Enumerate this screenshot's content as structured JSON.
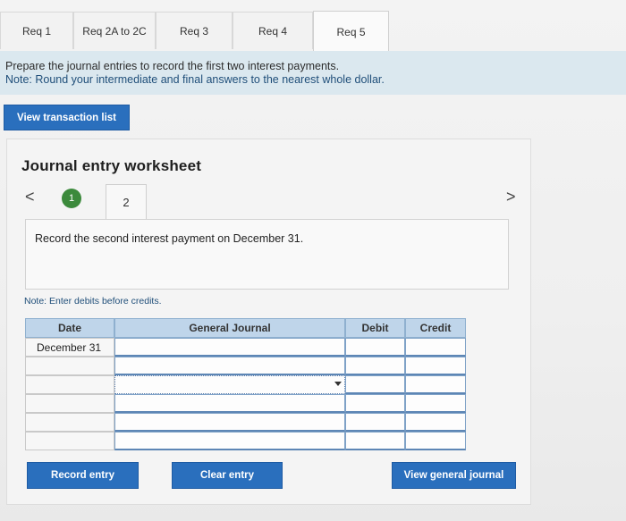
{
  "tabs": [
    {
      "label": "Req 1"
    },
    {
      "label": "Req 2A to 2C"
    },
    {
      "label": "Req 3"
    },
    {
      "label": "Req 4"
    },
    {
      "label": "Req 5",
      "active": true
    }
  ],
  "instructions": {
    "line1": "Prepare the journal entries to record the first two interest payments.",
    "line2": "Note: Round your intermediate and final answers to the nearest whole dollar."
  },
  "view_transaction_label": "View transaction list",
  "worksheet": {
    "title": "Journal entry worksheet",
    "prev_glyph": "<",
    "next_glyph": ">",
    "steps": [
      "1",
      "2"
    ],
    "active_step": "2",
    "instruction": "Record the second interest payment on December 31.",
    "note": "Note: Enter debits before credits."
  },
  "journal": {
    "headers": {
      "date": "Date",
      "account": "General Journal",
      "debit": "Debit",
      "credit": "Credit"
    },
    "rows": [
      {
        "date": "December 31",
        "account": "",
        "debit": "",
        "credit": ""
      },
      {
        "date": "",
        "account": "",
        "debit": "",
        "credit": ""
      },
      {
        "date": "",
        "account": "",
        "debit": "",
        "credit": ""
      },
      {
        "date": "",
        "account": "",
        "debit": "",
        "credit": ""
      },
      {
        "date": "",
        "account": "",
        "debit": "",
        "credit": ""
      },
      {
        "date": "",
        "account": "",
        "debit": "",
        "credit": ""
      }
    ]
  },
  "buttons": {
    "record": "Record entry",
    "clear": "Clear entry",
    "view_journal": "View general journal"
  },
  "colors": {
    "accent": "#2a6fbd",
    "banner": "#dbe8ef",
    "step_done": "#3c8a3c",
    "header": "#bfd5ea"
  }
}
